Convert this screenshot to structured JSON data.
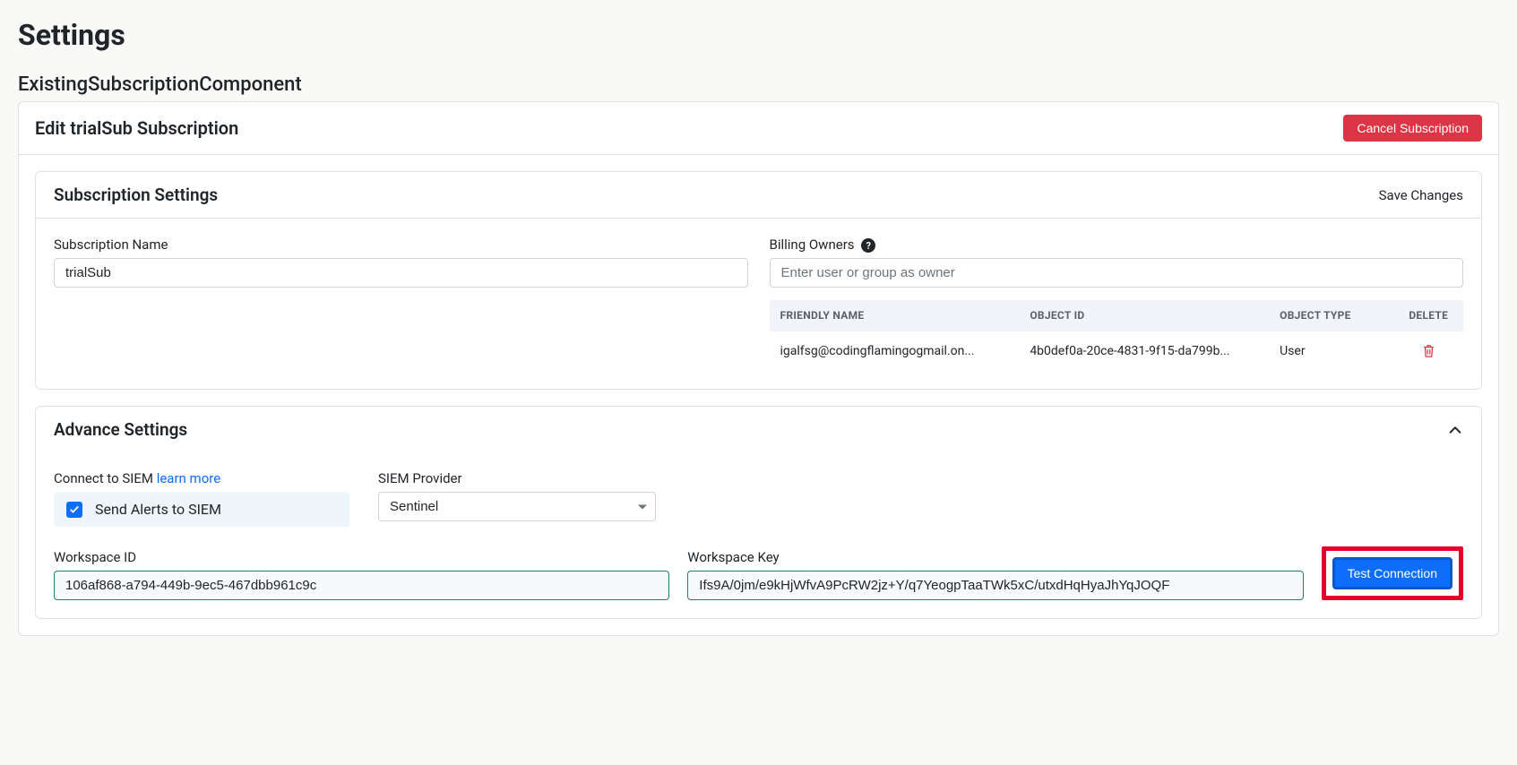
{
  "page": {
    "title": "Settings",
    "subtitle": "ExistingSubscriptionComponent"
  },
  "edit_card": {
    "title": "Edit trialSub Subscription",
    "cancel_btn": "Cancel Subscription"
  },
  "sub_settings": {
    "title": "Subscription Settings",
    "save": "Save Changes",
    "name_label": "Subscription Name",
    "name_value": "trialSub",
    "owners_label": "Billing Owners",
    "owners_placeholder": "Enter user or group as owner",
    "table": {
      "headers": {
        "friendly": "FRIENDLY NAME",
        "objid": "OBJECT ID",
        "objtype": "OBJECT TYPE",
        "del": "DELETE"
      },
      "rows": [
        {
          "friendly": "igalfsg@codingflamingogmail.on...",
          "objid": "4b0def0a-20ce-4831-9f15-da799b...",
          "objtype": "User"
        }
      ]
    }
  },
  "adv": {
    "title": "Advance Settings",
    "connect_label": "Connect to SIEM ",
    "learn_more": "learn more",
    "send_alerts": "Send Alerts to SIEM",
    "provider_label": "SIEM Provider",
    "provider_value": "Sentinel",
    "ws_id_label": "Workspace ID",
    "ws_id_value": "106af868-a794-449b-9ec5-467dbb961c9c",
    "ws_key_label": "Workspace Key",
    "ws_key_value": "Ifs9A/0jm/e9kHjWfvA9PcRW2jz+Y/q7YeogpTaaTWk5xC/utxdHqHyaJhYqJOQF",
    "test_btn": "Test Connection"
  }
}
